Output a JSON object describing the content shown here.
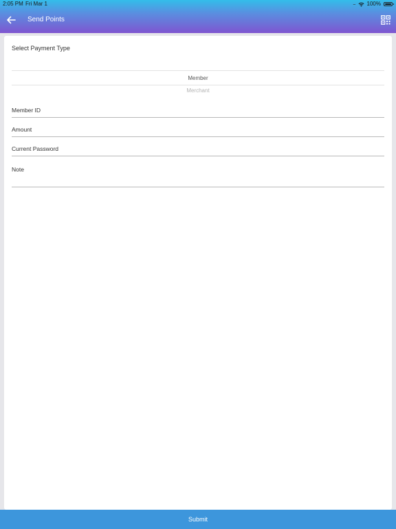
{
  "status_bar": {
    "time": "2:05 PM",
    "date": "Fri Mar 1",
    "signal": ".....",
    "battery": "100%"
  },
  "nav": {
    "back_icon": "arrow-left-icon",
    "title": "Send Points",
    "qr_icon": "qr-code-icon"
  },
  "form": {
    "payment_type_label": "Select Payment Type",
    "payment_options": [
      {
        "label": "Member",
        "selected": true
      },
      {
        "label": "Merchant",
        "selected": false
      }
    ],
    "fields": {
      "member_id": "Member ID",
      "amount": "Amount",
      "current_password": "Current Password",
      "note": "Note"
    }
  },
  "footer": {
    "submit_label": "Submit"
  },
  "colors": {
    "header_top": "#33bdea",
    "header_bottom": "#7f55d0",
    "submit": "#3d96dc",
    "background": "#e6e6ea"
  }
}
